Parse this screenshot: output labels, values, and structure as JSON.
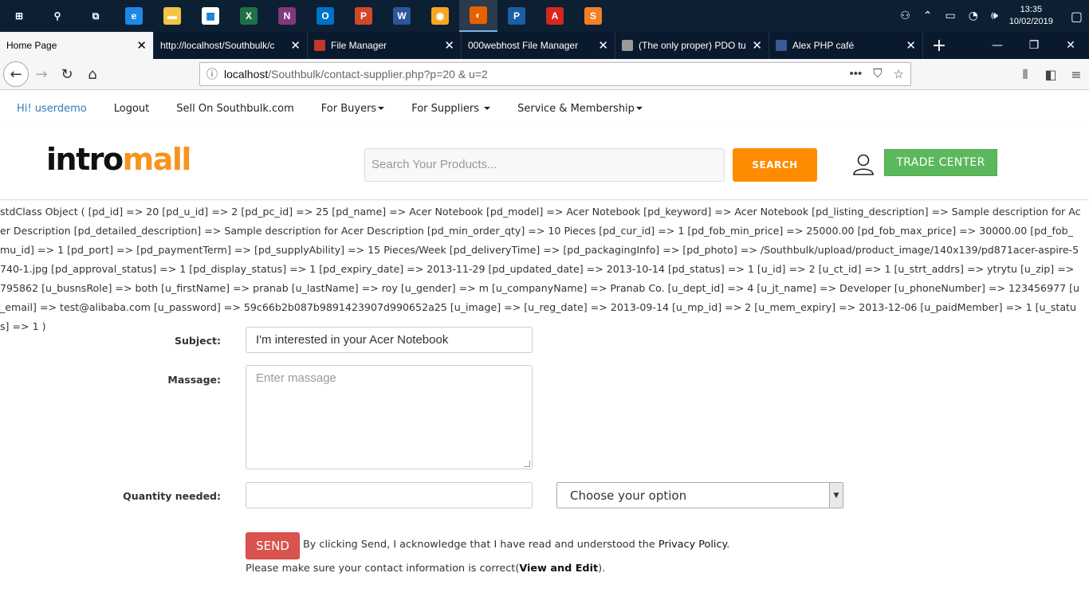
{
  "taskbar": {
    "apps": [
      {
        "name": "windows-start",
        "glyph": "⊞",
        "color": "#0d1f33"
      },
      {
        "name": "search",
        "glyph": "⚲",
        "color": "#0d1f33"
      },
      {
        "name": "task-view",
        "glyph": "⧉",
        "color": "#0d1f33"
      },
      {
        "name": "edge",
        "glyph": "e",
        "color": "#1e88e5"
      },
      {
        "name": "file-explorer",
        "glyph": "▬",
        "color": "#f4c542"
      },
      {
        "name": "store",
        "glyph": "▦",
        "color": "#ffffff"
      },
      {
        "name": "excel",
        "glyph": "X",
        "color": "#1e7145"
      },
      {
        "name": "onenote",
        "glyph": "N",
        "color": "#80397b"
      },
      {
        "name": "outlook",
        "glyph": "O",
        "color": "#0072c6"
      },
      {
        "name": "powerpoint",
        "glyph": "P",
        "color": "#d24726"
      },
      {
        "name": "word",
        "glyph": "W",
        "color": "#2b579a"
      },
      {
        "name": "uc-browser",
        "glyph": "◉",
        "color": "#f6a623"
      },
      {
        "name": "firefox",
        "glyph": "◐",
        "color": "#e66000"
      },
      {
        "name": "phpstorm",
        "glyph": "P",
        "color": "#1a5fa3"
      },
      {
        "name": "acrobat",
        "glyph": "A",
        "color": "#d7271d"
      },
      {
        "name": "sublime",
        "glyph": "S",
        "color": "#f48024"
      }
    ],
    "tray_icons": [
      "person-icon",
      "chevron-up-icon",
      "battery-icon",
      "wifi-icon",
      "volume-icon"
    ],
    "time": "13:35",
    "date": "10/02/2019"
  },
  "tabs": [
    {
      "label": "Home Page",
      "active": true,
      "fav": ""
    },
    {
      "label": "http://localhost/Southbulk/c",
      "active": false,
      "fav": ""
    },
    {
      "label": "File Manager",
      "active": false,
      "fav": "#c0392b"
    },
    {
      "label": "000webhost File Manager",
      "active": false,
      "fav": ""
    },
    {
      "label": "(The only proper) PDO tu",
      "active": false,
      "fav": "#999999"
    },
    {
      "label": "Alex PHP café",
      "active": false,
      "fav": "#3b5998"
    }
  ],
  "browser": {
    "url_host": "localhost",
    "url_rest": "/Southbulk/contact-supplier.php?p=20 & u=2"
  },
  "menu": {
    "greeting": "Hi! userdemo",
    "logout": "Logout",
    "sell": "Sell On Southbulk.com",
    "buyers": "For Buyers",
    "suppliers": "For Suppliers",
    "service": "Service & Membership"
  },
  "header": {
    "logo_part1": "intro",
    "logo_part2": "mall",
    "search_placeholder": "Search Your Products...",
    "search_button": "SEARCH",
    "trade_button": "TRADE CENTER"
  },
  "dump_text": "stdClass Object ( [pd_id] => 20 [pd_u_id] => 2 [pd_pc_id] => 25 [pd_name] => Acer Notebook [pd_model] => Acer Notebook [pd_keyword] => Acer Notebook [pd_listing_description] => Sample description for Acer Description [pd_detailed_description] => Sample description for Acer Description [pd_min_order_qty] => 10 Pieces [pd_cur_id] => 1 [pd_fob_min_price] => 25000.00 [pd_fob_max_price] => 30000.00 [pd_fob_mu_id] => 1 [pd_port] => [pd_paymentTerm] => [pd_supplyAbility] => 15 Pieces/Week [pd_deliveryTime] => [pd_packagingInfo] => [pd_photo] => /Southbulk/upload/product_image/140x139/pd871acer-aspire-5740-1.jpg [pd_approval_status] => 1 [pd_display_status] => 1 [pd_expiry_date] => 2013-11-29 [pd_updated_date] => 2013-10-14 [pd_status] => 1 [u_id] => 2 [u_ct_id] => 1 [u_strt_addrs] => ytrytu [u_zip] => 795862 [u_busnsRole] => both [u_firstName] => pranab [u_lastName] => roy [u_gender] => m [u_companyName] => Pranab Co. [u_dept_id] => 4 [u_jt_name] => Developer [u_phoneNumber] => 123456977 [u_email] => test@alibaba.com [u_password] => 59c66b2b087b9891423907d990652a25 [u_image] => [u_reg_date] => 2013-09-14 [u_mp_id] => 2 [u_mem_expiry] => 2013-12-06 [u_paidMember] => 1 [u_status] => 1 )",
  "form": {
    "subject_label": "Subject:",
    "subject_value": "I'm interested in your Acer Notebook",
    "message_label": "Massage:",
    "message_placeholder": "Enter massage",
    "quantity_label": "Quantity needed:",
    "quantity_value": "",
    "select_value": "Choose your option",
    "send_button": "SEND",
    "ack_text": "By clicking Send, I acknowledge that I have read and understood the ",
    "privacy_link": "Privacy Policy",
    "ack_end": ".",
    "contact_text": "Please make sure your contact information is correct(",
    "view_edit": "View and Edit",
    "contact_end": ")."
  }
}
